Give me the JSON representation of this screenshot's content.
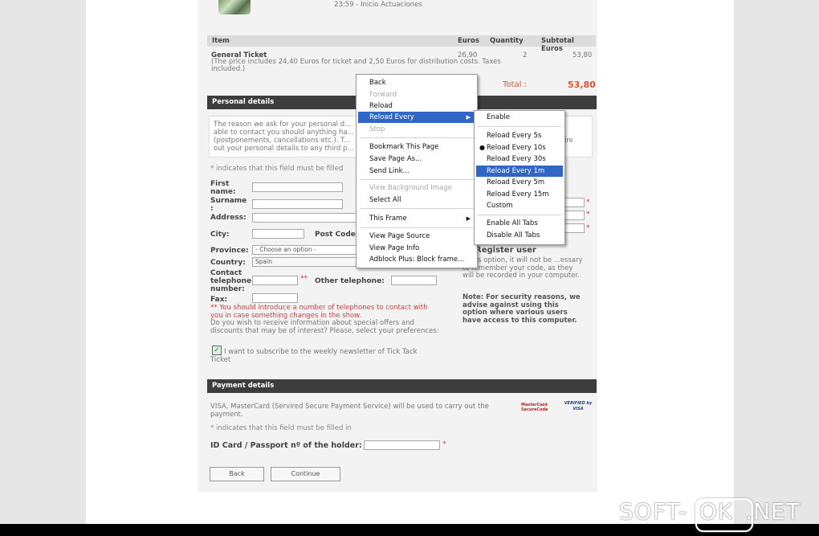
{
  "order": {
    "schedule_line": "23:59 - Inicio Actuaciones",
    "headers": {
      "item": "Item",
      "euros": "Euros",
      "quantity": "Quantity",
      "subtotal": "Subtotal Euros"
    },
    "item_name": "General Ticket",
    "item_note": "(The price includes 24,40 Euros for ticket and 2,50 Euros for distribution costs. Taxes included.)",
    "euros": "26,90",
    "quantity": "2",
    "subtotal": "53,80",
    "total_label": "Total :",
    "total_value": "53,80"
  },
  "personal": {
    "title": "Personal details",
    "intro": "The reason we ask for your personal d... able to contact you should anything ha... (postponements, cancellations etc.). T... out your personal details to any third p...",
    "intro_tail": "fire",
    "required_note": "* indicates that this field must be filled",
    "labels": {
      "first_name": "First name:",
      "surname": "Surname :",
      "address": "Address:",
      "city": "City:",
      "post_code": "Post Code",
      "province": "Province:",
      "country": "Country:",
      "contact_phone": "Contact telephone number:",
      "other_phone": "Other telephone:",
      "fax": "Fax:"
    },
    "province_placeholder": "- Choose an option -",
    "country_value": "Spain",
    "phone_note": "** You should introduce a number of telephones to contact with you in case something changes in the show.",
    "offers_question": "Do you wish to receive information about special offers and discounts that may be of interest? Please, select your preferences:",
    "newsletter_label": "I want to subscribe to the weekly newsletter of Tick Tack Ticket"
  },
  "register": {
    "title": "Register user",
    "text": "...this option, it will not be ...essary to remember your code, as they will be recorded in your computer.",
    "note": "Note: For security reasons, we advise against using this option where various users have access to this computer."
  },
  "payment": {
    "title": "Payment details",
    "text": "VISA, MasterCard (Servired Secure Payment Service) will be used to carry out the payment.",
    "required_note": "* indicates that this field must be filled in",
    "id_label": "ID Card / Passport nº of the holder:",
    "mastercard_label": "MasterCard SecureCode",
    "visa_label": "VERIFIED by VISA"
  },
  "buttons": {
    "back": "Back",
    "continue": "Continue"
  },
  "context_menu": {
    "items": [
      {
        "label": "Back",
        "disabled": false
      },
      {
        "label": "Forward",
        "disabled": true
      },
      {
        "label": "Reload",
        "disabled": false
      },
      {
        "label": "Reload Every",
        "disabled": false,
        "highlighted": true,
        "submenu": true
      },
      {
        "label": "Stop",
        "disabled": true
      },
      {
        "label": "Bookmark This Page",
        "disabled": false
      },
      {
        "label": "Save Page As...",
        "disabled": false
      },
      {
        "label": "Send Link...",
        "disabled": false
      },
      {
        "label": "View Background Image",
        "disabled": true
      },
      {
        "label": "Select All",
        "disabled": false
      },
      {
        "label": "This Frame",
        "disabled": false,
        "submenu": true
      },
      {
        "label": "View Page Source",
        "disabled": false
      },
      {
        "label": "View Page Info",
        "disabled": false
      },
      {
        "label": "Adblock Plus: Block frame...",
        "disabled": false
      }
    ]
  },
  "submenu": {
    "items": [
      {
        "label": "Enable"
      },
      {
        "label": "Reload Every 5s"
      },
      {
        "label": "Reload Every 10s",
        "checked": true
      },
      {
        "label": "Reload Every 30s"
      },
      {
        "label": "Reload Every 1m",
        "highlighted": true
      },
      {
        "label": "Reload Every 5m"
      },
      {
        "label": "Reload Every 15m"
      },
      {
        "label": "Custom"
      },
      {
        "label": "Enable All Tabs"
      },
      {
        "label": "Disable All Tabs"
      }
    ]
  },
  "watermark": {
    "left": "SOFT-",
    "box": "OK",
    "right": ".NET"
  },
  "colors": {
    "section_bar": "#3d3d3d",
    "total_red": "#e05030",
    "highlight": "#3166c7",
    "required": "#d04040"
  }
}
